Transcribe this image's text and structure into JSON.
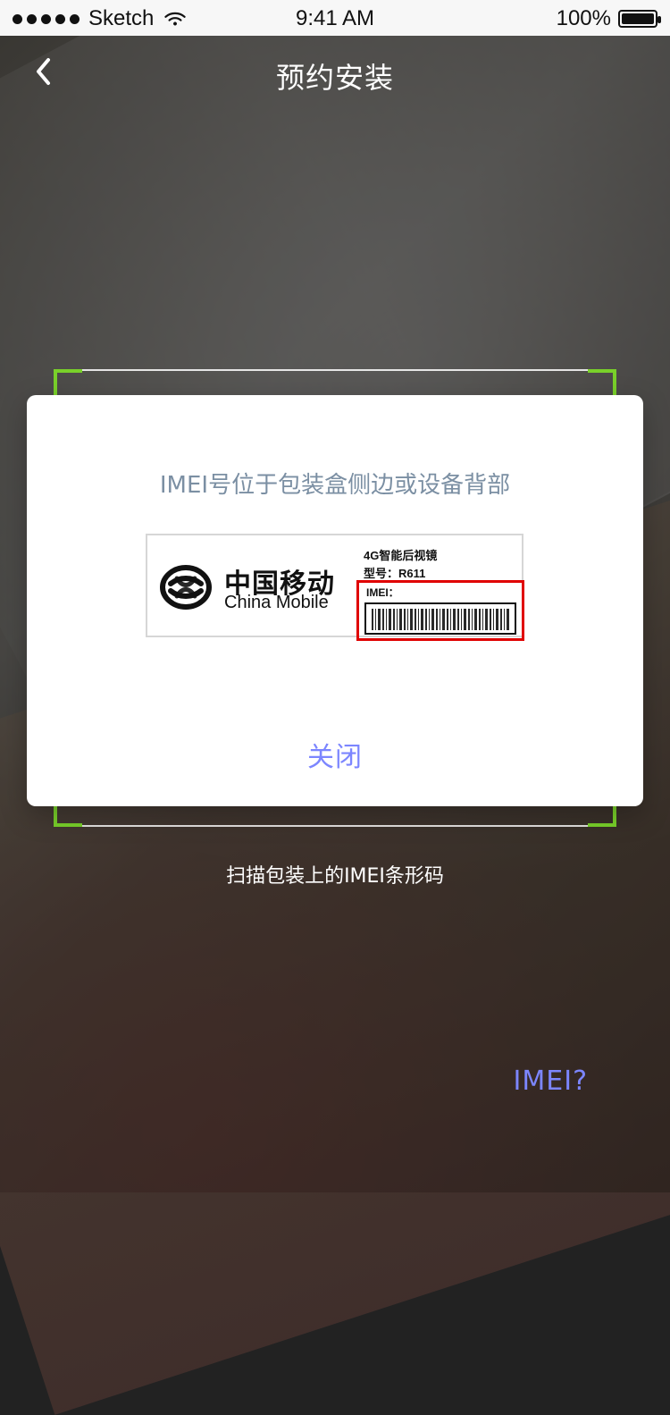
{
  "status_bar": {
    "carrier": "Sketch",
    "time": "9:41 AM",
    "battery_percent": "100%",
    "battery_level": 1.0
  },
  "nav": {
    "title": "预约安装"
  },
  "scan": {
    "hint": "扫描包装上的IMEI条形码",
    "imei_link": "IMEI?"
  },
  "modal": {
    "title": "IMEI号位于包装盒侧边或设备背部",
    "label": {
      "brand_cn": "中国移动",
      "brand_en": "China Mobile",
      "product": "4G智能后视镜",
      "model": "型号：R611",
      "imei_label": "IMEI："
    },
    "close_label": "关闭"
  },
  "colors": {
    "accent": "#7c86ff",
    "scan_corner": "#79d12a",
    "highlight_red": "#e00000",
    "modal_text": "#7b8fa3"
  },
  "icons": {
    "back": "chevron-left-icon",
    "wifi": "wifi-icon",
    "battery": "battery-icon",
    "logo": "china-mobile-logo"
  }
}
